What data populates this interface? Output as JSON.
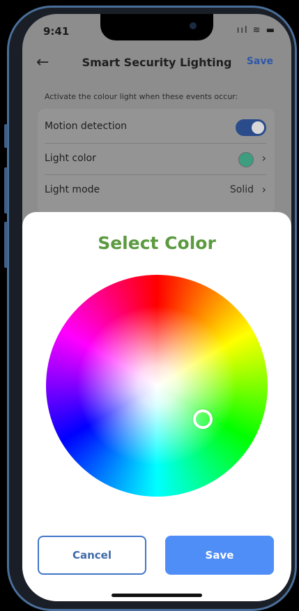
{
  "status_bar": {
    "time": "9:41",
    "icons": "ııl ≋ ▬"
  },
  "header": {
    "title": "Smart Security Lighting",
    "save_label": "Save"
  },
  "hint": "Activate the colour light when these events occur:",
  "settings": {
    "motion_label": "Motion detection",
    "motion_enabled": true,
    "light_color_label": "Light color",
    "light_color_value": "#3e9c7f",
    "light_mode_label": "Light mode",
    "light_mode_value": "Solid"
  },
  "color_picker": {
    "title": "Select Color",
    "cancel_label": "Cancel",
    "save_label": "Save"
  },
  "colors": {
    "accent": "#4f8ef7",
    "title_green": "#5b9a40",
    "toggle_on": "#2a4c8a"
  }
}
